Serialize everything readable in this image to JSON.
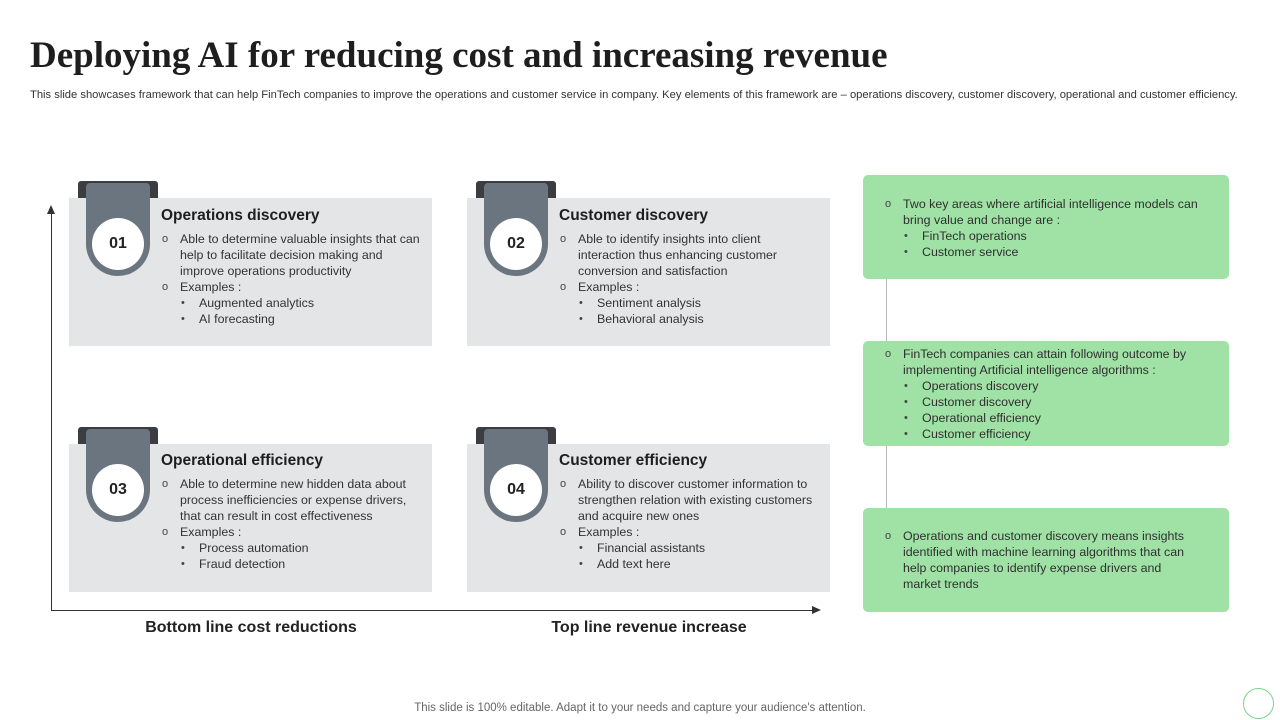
{
  "slide": {
    "title": "Deploying AI for reducing cost and increasing revenue",
    "subtitle": "This slide showcases framework that can help FinTech companies to improve the operations and customer service in company. Key elements of this framework are – operations discovery, customer discovery, operational and customer efficiency.",
    "footer": "This slide is 100% editable. Adapt it to your needs and capture your audience's attention."
  },
  "axes": {
    "x_left_label": "Bottom line cost reductions",
    "x_right_label": "Top line revenue increase"
  },
  "quadrants": [
    {
      "number": "01",
      "title": "Operations discovery",
      "description": "Able to determine valuable  insights that can help to facilitate decision making and improve  operations productivity",
      "examples_label": "Examples :",
      "examples": [
        "Augmented analytics",
        "AI forecasting"
      ]
    },
    {
      "number": "02",
      "title": "Customer discovery",
      "description": "Able to identify insights into client interaction thus enhancing customer conversion  and satisfaction",
      "examples_label": "Examples :",
      "examples": [
        "Sentiment analysis",
        "Behavioral  analysis"
      ]
    },
    {
      "number": "03",
      "title": "Operational efficiency",
      "description": "Able to determine new hidden data about process inefficiencies or expense drivers,  that can result in cost effectiveness",
      "examples_label": "Examples :",
      "examples": [
        "Process automation",
        "Fraud detection"
      ]
    },
    {
      "number": "04",
      "title": "Customer efficiency",
      "description": "Ability to discover customer information to strengthen relation with existing customers and acquire new ones",
      "examples_label": "Examples :",
      "examples": [
        "Financial assistants",
        "Add text here"
      ]
    }
  ],
  "side_notes": [
    {
      "text": "Two  key areas  where  artificial  intelligence models can bring value  and change are :",
      "items": [
        "FinTech  operations",
        "Customer service"
      ]
    },
    {
      "text": "FinTech  companies can attain following  outcome by implementing  Artificial intelligence algorithms :",
      "items": [
        "Operations discovery",
        "Customer discovery",
        "Operational efficiency",
        "Customer efficiency"
      ]
    },
    {
      "text": "Operations and customer discovery  means insights identified with machine learning algorithms that can help companies to identify expense drivers  and market trends",
      "items": []
    }
  ],
  "colors": {
    "card_background": "#e4e5e7",
    "badge_gray": "#6b7580",
    "badge_dark": "#3b3d40",
    "note_green": "#a0e2a6"
  }
}
